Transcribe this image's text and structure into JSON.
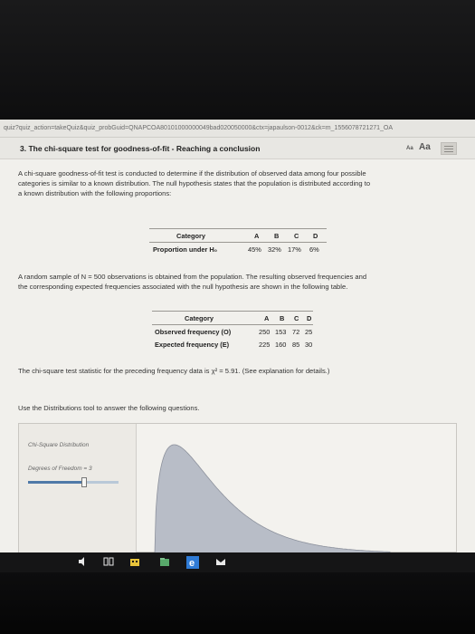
{
  "browser": {
    "url": "quiz?quiz_action=takeQuiz&quiz_probGuid=QNAPCOA80101000000049bad020050000&ctx=japaulson-0012&ck=m_1556078721271_OA"
  },
  "question": {
    "title": "3. The chi-square test for goodness-of-fit - Reaching a conclusion",
    "text_size_small": "Aa",
    "text_size_large": "Aa",
    "intro_lines": [
      "A chi-square goodness-of-fit test is conducted to determine if the distribution of observed data among four possible",
      "categories is similar to a known distribution. The null hypothesis states that the population is distributed according to",
      "a known distribution with the following proportions:"
    ],
    "proportion_table": {
      "header_label": "Category",
      "categories": [
        "A",
        "B",
        "C",
        "D"
      ],
      "row_label": "Proportion under H₀",
      "values": [
        "45%",
        "32%",
        "17%",
        "6%"
      ]
    },
    "sample_lines": [
      "A random sample of N = 500 observations is obtained from the population. The resulting observed frequencies and",
      "the corresponding expected frequencies associated with the null hypothesis are shown in the following table."
    ],
    "frequency_table": {
      "header_label": "Category",
      "categories": [
        "A",
        "B",
        "C",
        "D"
      ],
      "observed_label": "Observed frequency (O)",
      "observed": [
        "250",
        "153",
        "72",
        "25"
      ],
      "expected_label": "Expected frequency (E)",
      "expected": [
        "225",
        "160",
        "85",
        "30"
      ]
    },
    "statistic_line": "The chi-square test statistic for the preceding frequency data is χ² = 5.91. (See explanation for details.)",
    "instruction_line": "Use the Distributions tool to answer the following questions."
  },
  "tool": {
    "title": "Chi-Square Distribution",
    "dof_label": "Degrees of Freedom = 3",
    "dof_value": 3,
    "curve_fill": "#b8bdc7"
  },
  "taskbar": {
    "icons": [
      "speaker-icon",
      "task-view-icon",
      "store-icon",
      "file-explorer-icon",
      "edge-icon",
      "mail-icon"
    ]
  },
  "colors": {
    "slider_fill": "#4f79a8",
    "edge_blue": "#2f7bd6",
    "store_yellow": "#e8c33a",
    "explorer_green": "#58a86b"
  }
}
